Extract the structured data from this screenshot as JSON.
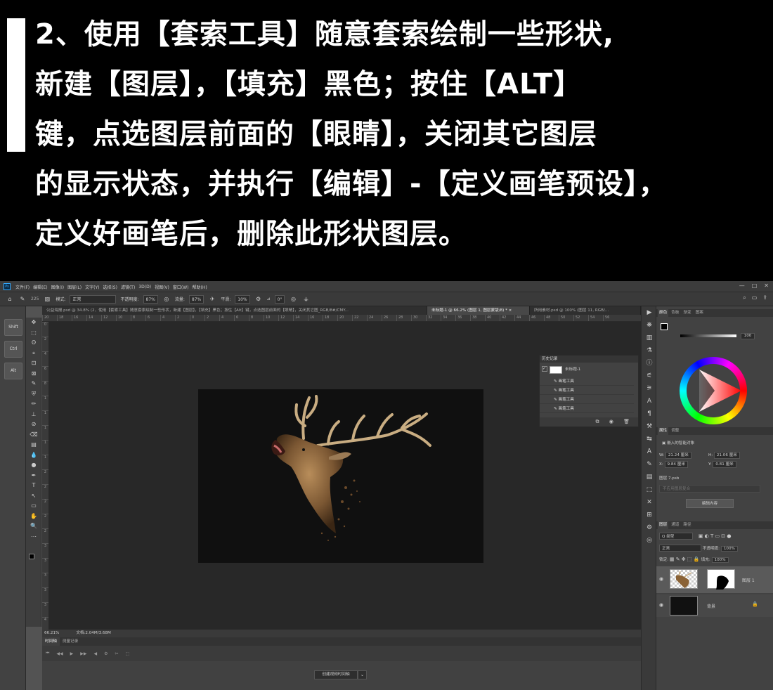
{
  "instructions": {
    "lines": [
      "2、使用【套索工具】随意套索绘制一些形状,",
      "新建【图层】，【填充】黑色；按住【ALT】",
      "键，点选图层前面的【眼睛】，关闭其它图层",
      "的显示状态，并执行【编辑】-【定义画笔预设】，",
      "定义好画笔后，删除此形状图层。"
    ]
  },
  "app": {
    "logo": "Ps",
    "menu": [
      "文件(F)",
      "编辑(E)",
      "图像(I)",
      "图层(L)",
      "文字(Y)",
      "选择(S)",
      "滤镜(T)",
      "3D(D)",
      "视图(V)",
      "窗口(W)",
      "帮助(H)"
    ],
    "window_buttons": [
      "—",
      "□",
      "✕"
    ]
  },
  "options": {
    "brush_size": "225",
    "mode_label": "模式:",
    "mode_value": "正常",
    "opacity_label": "不透明度:",
    "opacity_value": "87%",
    "flow_label": "流量:",
    "flow_value": "87%",
    "smooth_label": "平滑:",
    "smooth_value": "10%",
    "angle_value": "0°"
  },
  "tabs": [
    "公益海报.psd @ 34.8% (2、使用【套索工具】随意套索绘制一些形状，新建【图层】，【填充】黑色；按住【Alt】键，点选图层前面的【眼睛】，关闭其它图_RGB/8#/CMY...",
    "未标题-1 @ 66.2% (图层 1, 图层蒙版/8) * ×",
    "所用素材.psd @ 100% (图层 11, RGB/..."
  ],
  "ruler_h": [
    "20",
    "18",
    "16",
    "14",
    "12",
    "10",
    "8",
    "6",
    "4",
    "2",
    "0",
    "2",
    "4",
    "6",
    "8",
    "10",
    "12",
    "14",
    "16",
    "18",
    "20",
    "22",
    "24",
    "26",
    "28",
    "30",
    "32",
    "34",
    "36",
    "38",
    "40",
    "42",
    "44",
    "46",
    "48",
    "50",
    "52",
    "54",
    "56"
  ],
  "ruler_v": [
    "0",
    "2",
    "4",
    "6",
    "8",
    "1",
    "1",
    "1",
    "1",
    "1",
    "2",
    "2",
    "2",
    "2",
    "2",
    "3",
    "3",
    "3",
    "3",
    "3",
    "4"
  ],
  "keys": [
    "Shift",
    "Ctrl",
    "Alt"
  ],
  "tools": [
    "✥",
    "⬚",
    "ʘ",
    "⌖",
    "⊡",
    "⊠",
    "✎",
    "⛨",
    "✏",
    "⊥",
    "⊘",
    "⌫",
    "▤",
    "💧",
    "●",
    "✒",
    "T",
    "↖",
    "▭",
    "✋",
    "🔍",
    "⋯"
  ],
  "status": {
    "zoom": "66.21%",
    "doc": "文档:2.04M/3.68M"
  },
  "timeline": {
    "tabs": [
      "时间轴",
      "测量记录"
    ],
    "create_button": "创建视频时间轴",
    "controls": [
      "⏮",
      "◀◀",
      "▶",
      "▶▶",
      "◀",
      "⚙",
      "✂",
      "⬚"
    ]
  },
  "history": {
    "title": "历史记录",
    "snapshot": "未标题-1",
    "items": [
      "画笔工具",
      "画笔工具",
      "画笔工具",
      "画笔工具"
    ],
    "footer": "⧉ ◉ 🗑"
  },
  "icon_strip": [
    "▶",
    "❋",
    "▥",
    "⚗",
    "ⓘ",
    "⚟",
    "⚞",
    "A",
    "¶",
    "⚒",
    "↹",
    "Ａ",
    "✎",
    "▤",
    "⬚",
    "✕",
    "⊞",
    "⚙",
    "◎"
  ],
  "color_panel": {
    "tabs": [
      "颜色",
      "色板",
      "渐变",
      "图案"
    ],
    "slider_value": "100"
  },
  "properties": {
    "tabs": [
      "属性",
      "调整"
    ],
    "object": "嵌入的智能对象",
    "w_label": "W:",
    "w_value": "21.24 厘米",
    "h_label": "H:",
    "h_value": "21.06 厘米",
    "x_label": "X:",
    "x_value": "9.84 厘米",
    "y_label": "Y:",
    "y_value": "0.81 厘米",
    "layer_file": "图层 7.psb",
    "comp_placeholder": "不应用图层复合",
    "edit_button": "编辑内容"
  },
  "layers": {
    "tabs": [
      "图层",
      "通道",
      "路径"
    ],
    "filter_label": "Q 类型",
    "blend_mode": "正常",
    "opacity_label": "不透明度:",
    "opacity_value": "100%",
    "lock_label": "锁定:",
    "fill_label": "填充:",
    "fill_value": "100%",
    "items": [
      {
        "name": "图层 1"
      },
      {
        "name": "背景"
      }
    ]
  },
  "colors": {
    "accent": "#31a8ff",
    "bg": "#535353",
    "panel": "#424242"
  }
}
